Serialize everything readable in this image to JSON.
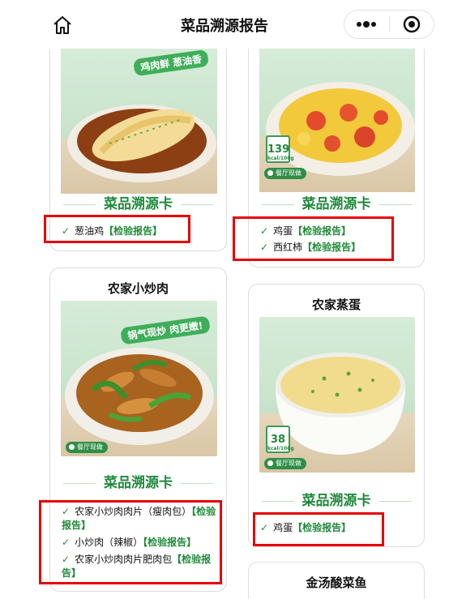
{
  "header": {
    "title": "菜品溯源报告",
    "home_icon": "home-icon",
    "more_icon": "more-dots-icon",
    "close_icon": "target-close-icon"
  },
  "cards": {
    "c1": {
      "slogan": "鸡肉鲜 葱油香",
      "trace_title": "菜品溯源卡",
      "items": [
        {
          "name": "葱油鸡",
          "report": "【检验报告】"
        }
      ]
    },
    "c2": {
      "kcal": "139",
      "kcal_unit": "kcal/100g",
      "tag": "餐厅现做",
      "trace_title": "菜品溯源卡",
      "items": [
        {
          "name": "鸡蛋",
          "report": "【检验报告】"
        },
        {
          "name": "西红柿",
          "report": "【检验报告】"
        }
      ]
    },
    "c3": {
      "name": "农家小炒肉",
      "slogan": "锅气现炒 肉更嫩!",
      "tag": "餐厅现做",
      "trace_title": "菜品溯源卡",
      "items": [
        {
          "name": "农家小炒肉肉片（瘦肉包）",
          "report": "【检验报告】"
        },
        {
          "name": "小炒肉（辣椒）",
          "report": "【检验报告】"
        },
        {
          "name": "农家小炒肉肉片肥肉包",
          "report": "【检验报告】"
        }
      ]
    },
    "c4": {
      "name": "农家蒸蛋",
      "kcal": "38",
      "kcal_unit": "kcal/100g",
      "tag": "餐厅现做",
      "trace_title": "菜品溯源卡",
      "items": [
        {
          "name": "鸡蛋",
          "report": "【检验报告】"
        }
      ]
    },
    "c5": {
      "name": "金汤酸菜鱼"
    }
  },
  "colors": {
    "accent_green": "#1f8a3a",
    "highlight_red": "#e60000"
  }
}
